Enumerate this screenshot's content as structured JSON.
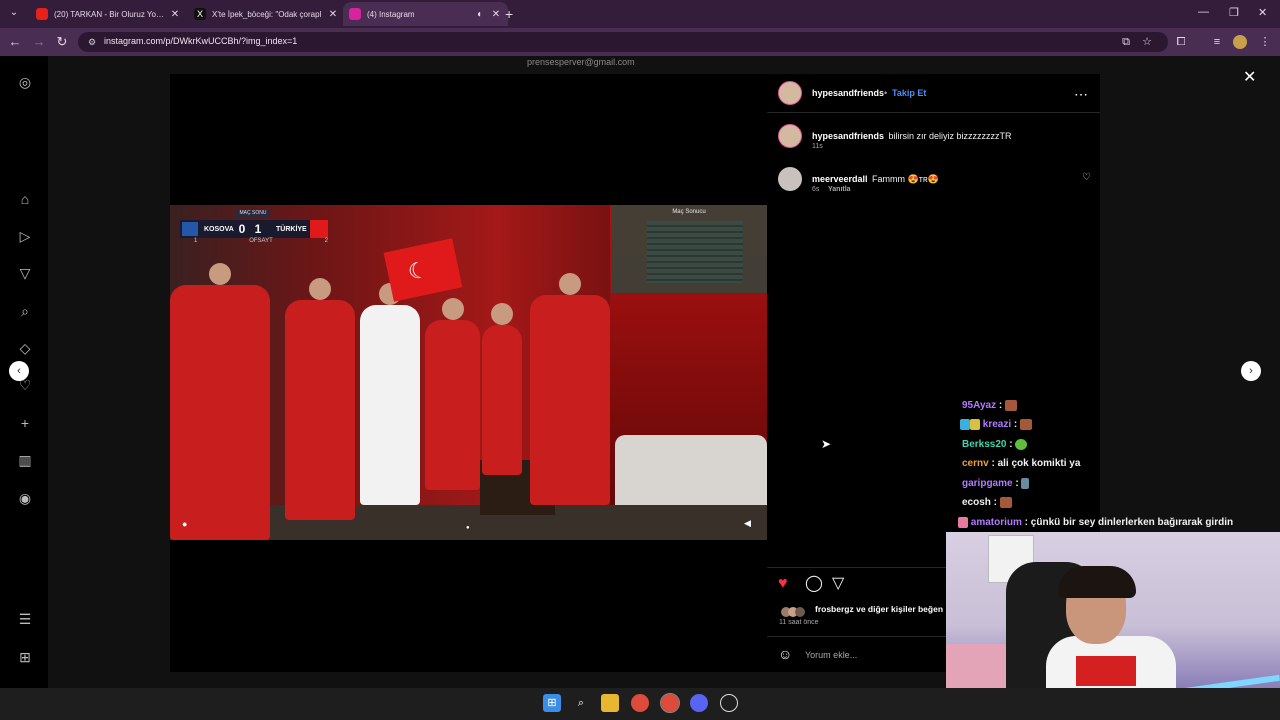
{
  "browser": {
    "tabs": [
      {
        "title": "(20) TARKAN - Bir Oluruz Yolun",
        "favicon": "youtube-icon",
        "color": "#e62117"
      },
      {
        "title": "X'te İpek_böceği: \"Odak çorapl",
        "favicon": "x-icon",
        "color": "#111111"
      },
      {
        "title": "(4) Instagram",
        "favicon": "instagram-icon",
        "color": "#d6249f"
      }
    ],
    "url": "instagram.com/p/DWkrKwUCCBh/?img_index=1"
  },
  "feed": {
    "email": "prensesperver@gmail.com"
  },
  "video": {
    "scoreboard": {
      "label": "MAÇ SONU",
      "team1": "KOSOVA",
      "score1": "0",
      "score2": "1",
      "team2": "TÜRKİYE",
      "sub1": "1",
      "offside": "OFSAYT",
      "sub2": "2"
    },
    "match_box_title": "Maç Sonucu"
  },
  "post": {
    "author": "hypesandfriends",
    "follow_label": "Takip Et",
    "caption": {
      "user": "hypesandfriends",
      "text": "bilirsin zır deliyiz bizzzzzzzzTR",
      "time": "11s"
    },
    "comments": [
      {
        "user": "meerveerdall",
        "text": "Fammm 😍ᴛʀ😍",
        "time": "6s",
        "reply_label": "Yanıtla"
      }
    ],
    "likes_text": "frosbergz ve diğer kişiler beğen",
    "timestamp": "11 saat önce",
    "comment_placeholder": "Yorum ekle..."
  },
  "stream_chat": [
    {
      "name": "95Ayaz",
      "message": "",
      "color": "#b27bff"
    },
    {
      "name": "kreazi",
      "message": "",
      "color": "#b27bff"
    },
    {
      "name": "Berkss20",
      "message": "",
      "color": "#3fd4b0"
    },
    {
      "name": "cernv",
      "message": "ali çok komikti ya",
      "color": "#e8a23c"
    },
    {
      "name": "garipgame",
      "message": "",
      "color": "#b27bff"
    },
    {
      "name": "ecosh",
      "message": "",
      "color": "#f0f0f0"
    },
    {
      "name": "amatorium",
      "message": "çünkü bir sey dinlerlerken bağırarak girdin",
      "color": "#b27bff"
    }
  ],
  "colors": {
    "like": "#ff3040",
    "link": "#4a8df8",
    "tabbar": "#331d3a"
  }
}
